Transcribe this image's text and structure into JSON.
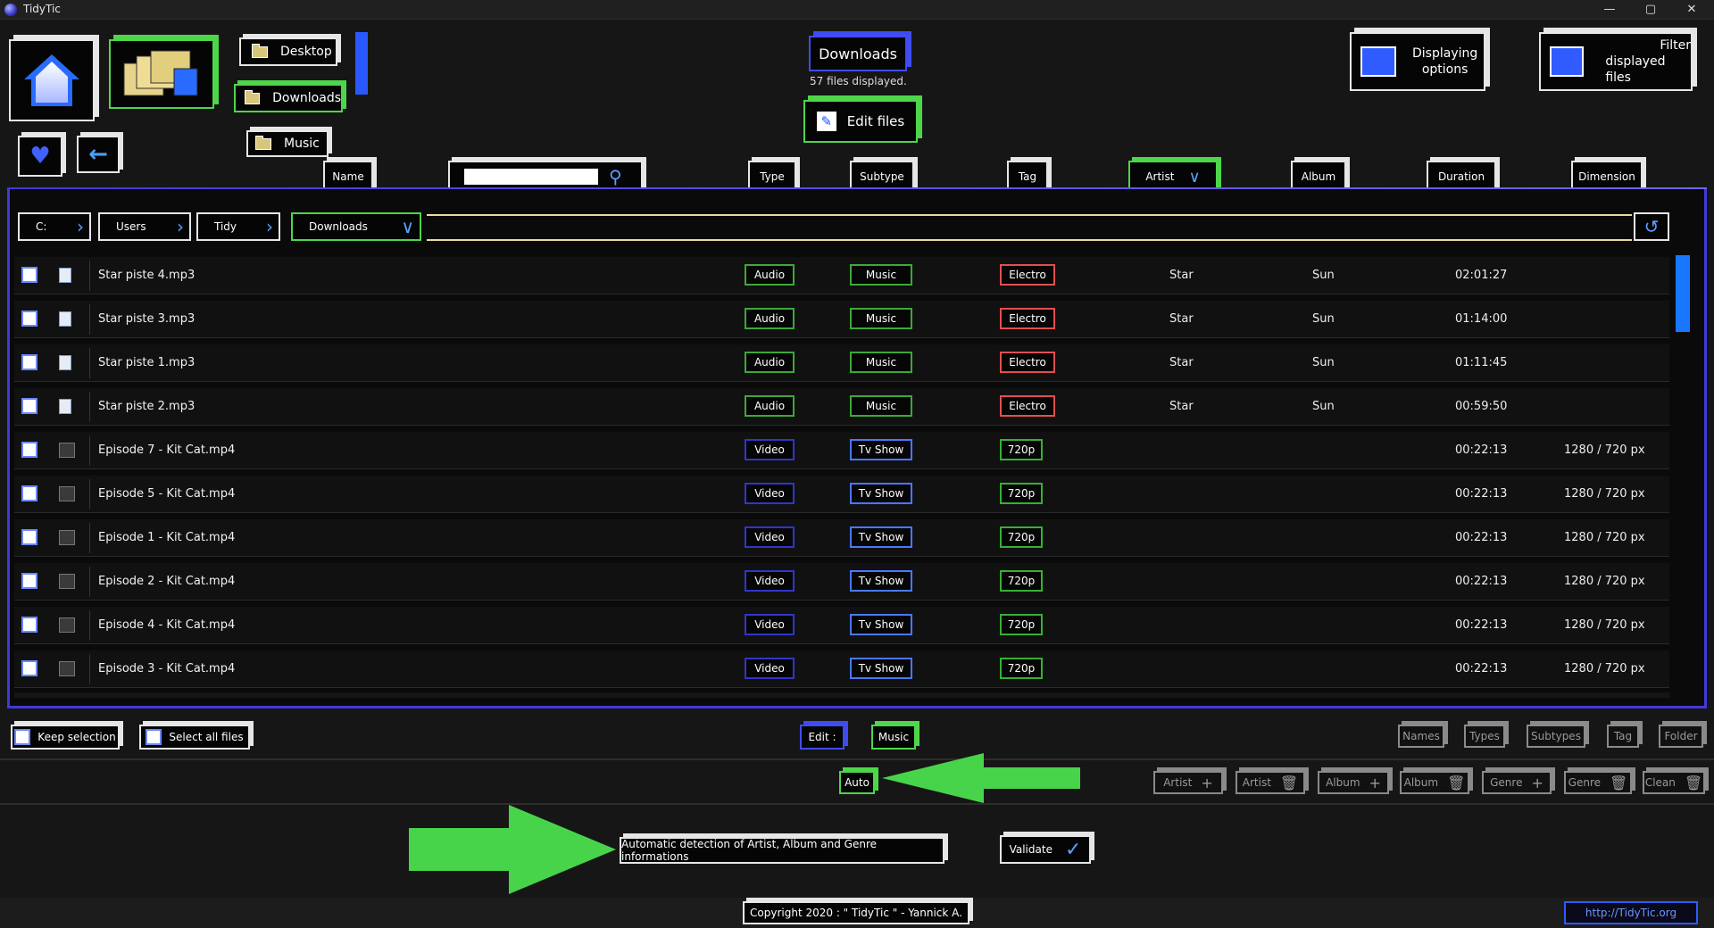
{
  "window": {
    "title": "TidyTic",
    "controls": [
      "—",
      "▢",
      "✕"
    ]
  },
  "nav": {
    "home_icon": "house-icon",
    "folders_icon": "folders-icon",
    "favorites_icon": "heart-icon",
    "back_icon": "arrow-left-icon",
    "desktop": "Desktop",
    "downloads": "Downloads",
    "music": "Music"
  },
  "header": {
    "current_folder": "Downloads",
    "files_count": "57 files displayed.",
    "edit_files": "Edit files",
    "displaying_options_line1": "Displaying",
    "displaying_options_line2": "options",
    "filter_line1": "Filter",
    "filter_line2": "displayed files"
  },
  "columns": {
    "name": "Name",
    "search_value": "",
    "type": "Type",
    "subtype": "Subtype",
    "tag": "Tag",
    "artist": "Artist",
    "album": "Album",
    "duration": "Duration",
    "dimension": "Dimension"
  },
  "breadcrumb": [
    "C:",
    "Users",
    "Tidy",
    "Downloads"
  ],
  "files": [
    {
      "name": "Star piste 4.mp3",
      "type": "Audio",
      "subtype": "Music",
      "tag": "Electro",
      "artist": "Star",
      "album": "Sun",
      "duration": "02:01:27",
      "dimension": ""
    },
    {
      "name": "Star piste 3.mp3",
      "type": "Audio",
      "subtype": "Music",
      "tag": "Electro",
      "artist": "Star",
      "album": "Sun",
      "duration": "01:14:00",
      "dimension": ""
    },
    {
      "name": "Star piste 1.mp3",
      "type": "Audio",
      "subtype": "Music",
      "tag": "Electro",
      "artist": "Star",
      "album": "Sun",
      "duration": "01:11:45",
      "dimension": ""
    },
    {
      "name": "Star piste 2.mp3",
      "type": "Audio",
      "subtype": "Music",
      "tag": "Electro",
      "artist": "Star",
      "album": "Sun",
      "duration": "00:59:50",
      "dimension": ""
    },
    {
      "name": "Episode 7 - Kit Cat.mp4",
      "type": "Video",
      "subtype": "Tv Show",
      "tag": "720p",
      "artist": "",
      "album": "",
      "duration": "00:22:13",
      "dimension": "1280 / 720 px"
    },
    {
      "name": "Episode 5 - Kit Cat.mp4",
      "type": "Video",
      "subtype": "Tv Show",
      "tag": "720p",
      "artist": "",
      "album": "",
      "duration": "00:22:13",
      "dimension": "1280 / 720 px"
    },
    {
      "name": "Episode 1 - Kit Cat.mp4",
      "type": "Video",
      "subtype": "Tv Show",
      "tag": "720p",
      "artist": "",
      "album": "",
      "duration": "00:22:13",
      "dimension": "1280 / 720 px"
    },
    {
      "name": "Episode 2 - Kit Cat.mp4",
      "type": "Video",
      "subtype": "Tv Show",
      "tag": "720p",
      "artist": "",
      "album": "",
      "duration": "00:22:13",
      "dimension": "1280 / 720 px"
    },
    {
      "name": "Episode 4 - Kit Cat.mp4",
      "type": "Video",
      "subtype": "Tv Show",
      "tag": "720p",
      "artist": "",
      "album": "",
      "duration": "00:22:13",
      "dimension": "1280 / 720 px"
    },
    {
      "name": "Episode 3 - Kit Cat.mp4",
      "type": "Video",
      "subtype": "Tv Show",
      "tag": "720p",
      "artist": "",
      "album": "",
      "duration": "00:22:13",
      "dimension": "1280 / 720 px"
    }
  ],
  "bottom": {
    "keep_selection": "Keep selection",
    "select_all": "Select all files",
    "edit_label": "Edit :",
    "edit_mode": "Music",
    "names": "Names",
    "types": "Types",
    "subtypes": "Subtypes",
    "tag": "Tag",
    "folder": "Folder",
    "auto": "Auto",
    "artist_add": "Artist",
    "artist_del": "Artist",
    "album_add": "Album",
    "album_del": "Album",
    "genre_add": "Genre",
    "genre_del": "Genre",
    "clean": "Clean",
    "auto_detection": "Automatic detection of Artist, Album and Genre informations",
    "validate": "Validate"
  },
  "footer": {
    "copyright": "Copyright 2020 : \" TidyTic \" - Yannick A.",
    "link": "http://TidyTic.org"
  },
  "colors": {
    "accent_blue": "#4139d9",
    "accent_green": "#4ed64a",
    "tag_red": "#e05050",
    "annotation_arrow": "#48d44a"
  }
}
